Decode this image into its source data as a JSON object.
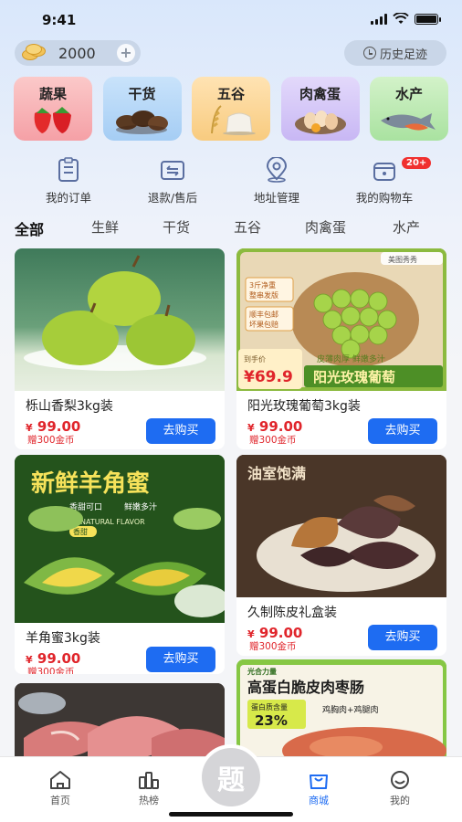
{
  "status": {
    "time": "9:41"
  },
  "header": {
    "coins": "2000",
    "history_label": "历史足迹"
  },
  "categories": [
    {
      "label": "蔬果",
      "icon": "strawberry-icon"
    },
    {
      "label": "干货",
      "icon": "mushroom-icon"
    },
    {
      "label": "五谷",
      "icon": "grain-icon"
    },
    {
      "label": "肉禽蛋",
      "icon": "egg-icon"
    },
    {
      "label": "水产",
      "icon": "fish-icon"
    }
  ],
  "shortcuts": [
    {
      "label": "我的订单",
      "icon": "order-icon"
    },
    {
      "label": "退款/售后",
      "icon": "refund-icon"
    },
    {
      "label": "地址管理",
      "icon": "location-icon"
    },
    {
      "label": "我的购物车",
      "icon": "cart-icon",
      "badge": "20+"
    }
  ],
  "tabs": [
    "全部",
    "生鲜",
    "干货",
    "五谷",
    "肉禽蛋",
    "水产"
  ],
  "products": [
    {
      "name": "栎山香梨3kg装",
      "price": "99.00",
      "currency": "¥",
      "reward": "赠300金币",
      "buy_label": "去购买"
    },
    {
      "name": "阳光玫瑰葡萄3kg装",
      "price": "99.00",
      "currency": "¥",
      "reward": "赠300金币",
      "buy_label": "去购买",
      "image_text": {
        "brand": "美图秀秀",
        "net": "3斤净重",
        "box": "整串发版",
        "ship": "顺丰包邮",
        "refund": "坏果包赔",
        "tagline": "皮薄肉厚  鲜嫩多汁",
        "price_tag": "到手价",
        "price": "¥69.9",
        "banner": "阳光玫瑰葡萄"
      }
    },
    {
      "name": "羊角蜜3kg装",
      "price": "99.00",
      "currency": "¥",
      "reward": "赠300金币",
      "buy_label": "去购买",
      "image_text": {
        "headline": "新鲜羊角蜜",
        "sub1": "香甜可口",
        "sub2": "鲜嫩多汁",
        "en": "NATURAL FLAVOR",
        "tag": "香甜"
      }
    },
    {
      "name": "久制陈皮礼盒装",
      "price": "99.00",
      "currency": "¥",
      "reward": "赠300金币",
      "buy_label": "去购买",
      "image_text": {
        "headline": "油室饱满"
      }
    },
    {
      "name": "",
      "image_text": {}
    },
    {
      "name": "",
      "image_text": {
        "brand": "光合力量",
        "headline": "高蛋白脆皮肉枣肠",
        "protein": "蛋白质含量",
        "pct": "23%",
        "combo": "鸡胸肉+鸡腿肉"
      }
    }
  ],
  "tabbar": [
    {
      "label": "首页",
      "icon": "home-icon"
    },
    {
      "label": "热榜",
      "icon": "hot-list-icon"
    },
    {
      "label": "题",
      "icon": "question-bank-icon"
    },
    {
      "label": "商城",
      "icon": "shop-bag-icon"
    },
    {
      "label": "我的",
      "icon": "profile-icon"
    }
  ],
  "colors": {
    "accent": "#1e6cf2",
    "price": "#e0252b",
    "badge": "#f0302f"
  }
}
